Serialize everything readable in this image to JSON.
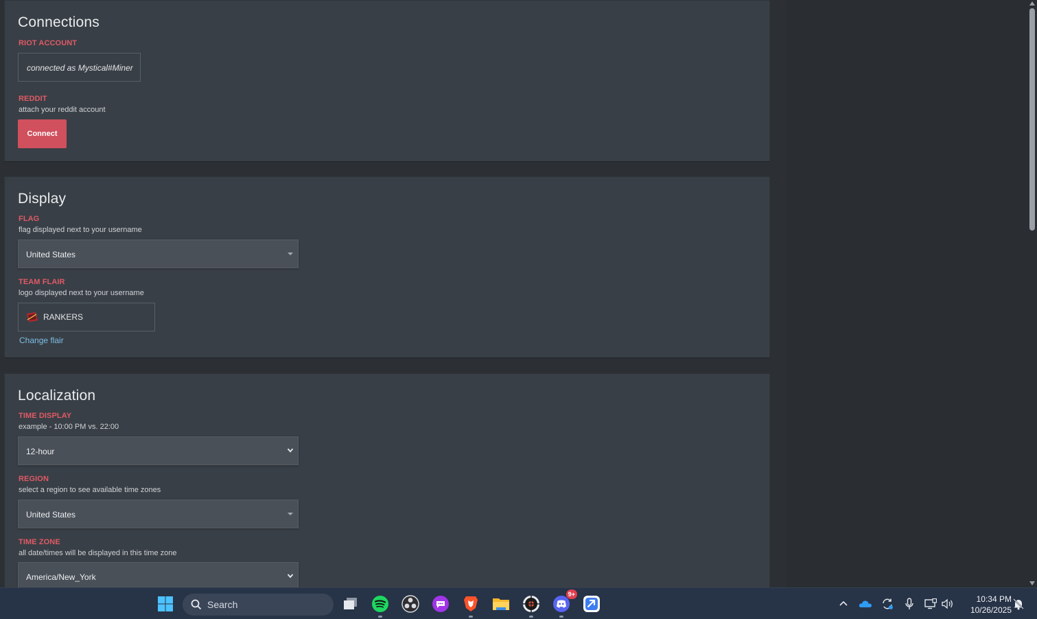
{
  "connections": {
    "title": "Connections",
    "riot_label": "RIOT ACCOUNT",
    "riot_value": "connected as Mystical#Miner",
    "reddit_label": "REDDIT",
    "reddit_hint": "attach your reddit account",
    "connect_button": "Connect"
  },
  "display": {
    "title": "Display",
    "flag_label": "FLAG",
    "flag_hint": "flag displayed next to your username",
    "flag_value": "United States",
    "team_label": "TEAM FLAIR",
    "team_hint": "logo displayed next to your username",
    "team_value": "RANKERS",
    "change_flair": "Change flair"
  },
  "localization": {
    "title": "Localization",
    "time_label": "TIME DISPLAY",
    "time_hint": "example - 10:00 PM vs. 22:00",
    "time_value": "12-hour",
    "region_label": "REGION",
    "region_hint": "select a region to see available time zones",
    "region_value": "United States",
    "tz_label": "TIME ZONE",
    "tz_hint": "all date/times will be displayed in this time zone",
    "tz_value": "America/New_York"
  },
  "taskbar": {
    "search_placeholder": "Search",
    "discord_badge": "9+",
    "time": "10:34 PM",
    "date": "10/26/2025",
    "apps": [
      "windows-start-icon",
      "task-view-icon",
      "spotify-icon",
      "obs-icon",
      "chat-app-icon",
      "brave-browser-icon",
      "file-explorer-icon",
      "game-client-icon",
      "discord-icon",
      "app-icon"
    ],
    "tray": [
      "chevron-up-icon",
      "onedrive-icon",
      "sync-icon",
      "microphone-icon",
      "network-icon",
      "volume-icon",
      "notification-icon"
    ]
  },
  "colors": {
    "accent_red": "#e05a66",
    "button_red": "#d0505e",
    "link_blue": "#7cbfe6",
    "panel_bg": "#393f46",
    "page_bg": "#2c3035",
    "taskbar_bg": "#273347"
  }
}
